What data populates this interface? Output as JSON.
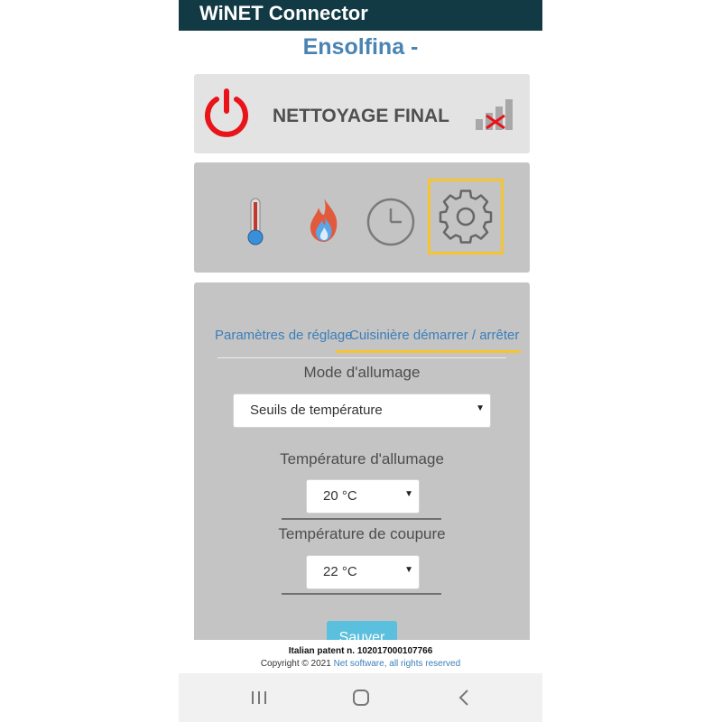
{
  "app_title": "WiNET Connector",
  "device_name": "Ensolfina -",
  "status": {
    "text": "NETTOYAGE FINAL",
    "power_icon": "power-icon",
    "signal_icon": "signal-disconnected-icon",
    "power_color": "#e8141a"
  },
  "nav": {
    "items": [
      {
        "name": "temperature",
        "icon": "thermometer-icon"
      },
      {
        "name": "flame",
        "icon": "flame-icon"
      },
      {
        "name": "schedule",
        "icon": "clock-icon"
      },
      {
        "name": "settings",
        "icon": "gear-icon",
        "active": true
      }
    ],
    "active_color": "#f6c431"
  },
  "tabs": [
    {
      "label": "Paramètres de réglage"
    },
    {
      "label": "Cuisinière démarrer / arrêter",
      "active": true
    }
  ],
  "ignition_mode": {
    "label": "Mode d'allumage",
    "value": "Seuils de température"
  },
  "ignition_temp": {
    "label": "Température d'allumage",
    "value": "20 °C"
  },
  "cutoff_temp": {
    "label": "Température de coupure",
    "value": "22 °C"
  },
  "save_label": "Sauver",
  "footer": {
    "patent": "Italian patent n. 102017000107766",
    "copyright_prefix": "Copyright © 2021 ",
    "copyright_link": "Net software, all rights reserved"
  },
  "android_nav": [
    "recent-apps-icon",
    "home-icon",
    "back-icon"
  ]
}
